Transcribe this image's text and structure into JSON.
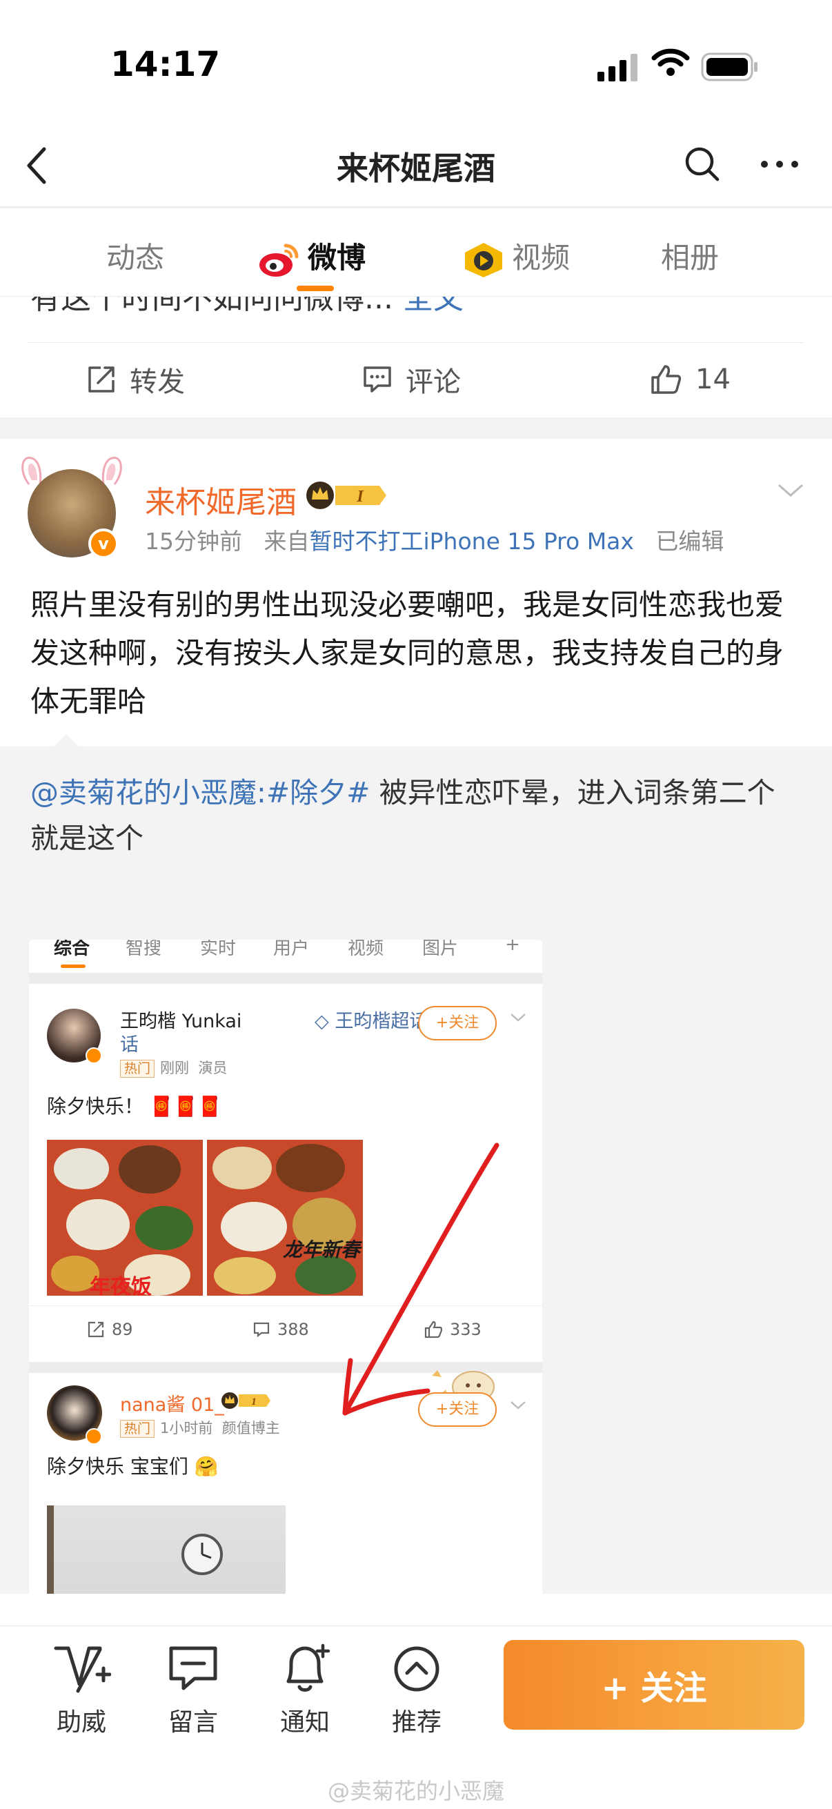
{
  "status_bar": {
    "time": "14:17"
  },
  "nav": {
    "title": "来杯姬尾酒"
  },
  "tabs": [
    {
      "label": "动态"
    },
    {
      "label": "微博"
    },
    {
      "label": "视频"
    },
    {
      "label": "相册"
    }
  ],
  "prev_post": {
    "truncated_text": "有这个时间不如问问微博...",
    "full_text_link": "全文",
    "repost_label": "转发",
    "comment_label": "评论",
    "like_count": "14"
  },
  "post": {
    "author": "来杯姬尾酒",
    "level_badge": "I",
    "time": "15分钟前",
    "source_prefix": "来自",
    "source": "暂时不打工iPhone 15 Pro Max",
    "edited": "已编辑",
    "text": "照片里没有别的男性出现没必要嘲吧，我是女同性恋我也爱发这种啊，没有按头人家是女同的意思，我支持发自己的身体无罪哈",
    "repost": {
      "mention": "@卖菊花的小恶魔:#除夕#",
      "text": " 被异性恋吓晕，进入词条第二个就是这个",
      "screenshot": {
        "tabs": [
          "综合",
          "智搜",
          "实时",
          "用户",
          "视频",
          "图片",
          "+"
        ],
        "post1": {
          "author": "王昀楷 Yunkai",
          "super_topic": "王昀楷超话",
          "hot_tag": "热门",
          "time": "刚刚",
          "role": "演员",
          "follow": "+关注",
          "body": "除夕快乐！",
          "img_caption1": "年夜饭",
          "img_caption2": "龙年新春",
          "reposts": "89",
          "comments": "388",
          "likes": "333"
        },
        "post2": {
          "author": "nana酱 01_",
          "level": "1",
          "hot_tag": "热门",
          "time": "1小时前",
          "role": "颜值博主",
          "follow": "+关注",
          "body": "除夕快乐 宝宝们"
        }
      }
    }
  },
  "bottom_bar": {
    "items": [
      {
        "label": "助威",
        "icon": "cheer-icon"
      },
      {
        "label": "留言",
        "icon": "message-icon"
      },
      {
        "label": "通知",
        "icon": "bell-icon"
      },
      {
        "label": "推荐",
        "icon": "recommend-icon"
      }
    ],
    "follow_label": "+ 关注"
  },
  "watermark": "@卖菊花的小恶魔",
  "colors": {
    "accent": "#ff8200",
    "link": "#3e74b7",
    "author": "#f0682a"
  }
}
